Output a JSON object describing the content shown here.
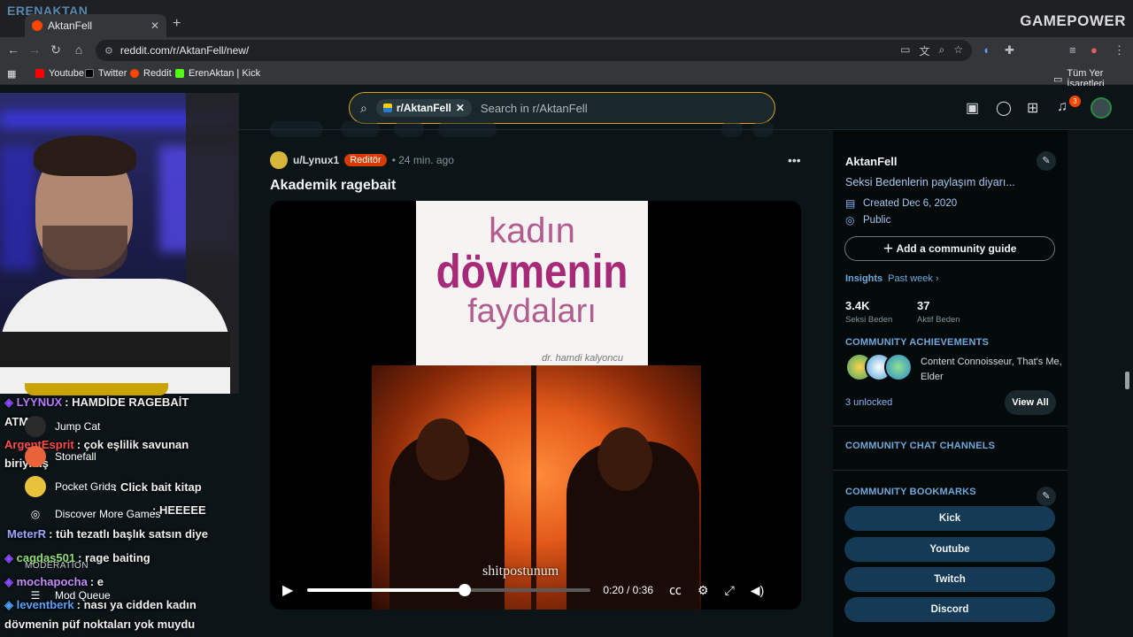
{
  "browser": {
    "watermark": "ERENAKTAN",
    "tab_title": "AktanFell",
    "new_tab": "+",
    "url": "reddit.com/r/AktanFell/new/",
    "brand": "GAMEPOWER",
    "bookmarks": [
      {
        "label": "Youtube",
        "color": "#ff0000"
      },
      {
        "label": "Twitter",
        "color": "#000000"
      },
      {
        "label": "Reddit",
        "color": "#ff4500"
      },
      {
        "label": "ErenAktan | Kick",
        "color": "#53fc18"
      }
    ],
    "all_bookmarks": "Tüm Yer İşaretleri"
  },
  "header": {
    "community_chip": "r/AktanFell",
    "search_placeholder": "Search in r/AktanFell",
    "notifications_count": "3"
  },
  "post": {
    "author": "u/Lynux1",
    "flair": "Reditör",
    "time": "• 24 min. ago",
    "title": "Akademik ragebait",
    "book_line1": "kadın",
    "book_line2": "dövmenin",
    "book_line3": "faydaları",
    "book_author": "dr. hamdi kalyoncu",
    "video_caption": "shitpostunum",
    "video_time": "0:20 / 0:36",
    "video_progress": 0.5556
  },
  "sidebar": {
    "name": "AktanFell",
    "description": "Seksi Bedenlerin paylaşım diyarı...",
    "created": "Created Dec 6, 2020",
    "visibility": "Public",
    "guide_button": "Add a community guide",
    "insights_label": "Insights",
    "insights_period": "Past week ›",
    "stats": [
      {
        "value": "3.4K",
        "label": "Seksi Beden"
      },
      {
        "value": "37",
        "label": "Aktif Beden"
      }
    ],
    "achievements_title": "COMMUNITY ACHIEVEMENTS",
    "achievements_text": "Content Connoisseur, That's Me, Elder",
    "unlocked": "3 unlocked",
    "view_all": "View All",
    "chat_channels_title": "COMMUNITY CHAT CHANNELS",
    "bookmarks_title": "COMMUNITY BOOKMARKS",
    "bookmark_buttons": [
      "Kick",
      "Youtube",
      "Twitch",
      "Discord"
    ]
  },
  "chat": {
    "lines": [
      {
        "user": "LYYNUX",
        "user_color": "#b57bff",
        "text": ": HAMDİDE RAGEBAİT"
      },
      {
        "user": "",
        "user_color": "#ffffff",
        "text": "ATMIŞ"
      },
      {
        "user": "ArgentEsprit",
        "user_color": "#ff4d4d",
        "text": ": çok eşlilik savunan"
      },
      {
        "user": "",
        "user_color": "#ffffff",
        "text": "biriymiş"
      },
      {
        "user": "",
        "user_color": "#ffffff",
        "text": ": Click bait kitap"
      },
      {
        "user": "",
        "user_color": "#ff5a5a",
        "text": ": HEEEEE"
      },
      {
        "user": "MeterR",
        "user_color": "#9aa6ff",
        "text": ": tüh tezatlı başlık satsın diye"
      },
      {
        "user": "cagdas501",
        "user_color": "#8ee07a",
        "text": ": rage baiting"
      },
      {
        "user": "mochapocha",
        "user_color": "#c58cff",
        "text": ": e"
      },
      {
        "user": "leventberk",
        "user_color": "#5aa0ff",
        "text": ": nası ya cidden kadın"
      },
      {
        "user": "",
        "user_color": "#ffffff",
        "text": "dövmenin püf noktaları yok muydu"
      }
    ],
    "menu": [
      "Jump Cat",
      "Stonefall",
      "Pocket Grids",
      "Discover More Games"
    ],
    "moderation_label": "MODERATION",
    "mod_queue": "Mod Queue"
  }
}
